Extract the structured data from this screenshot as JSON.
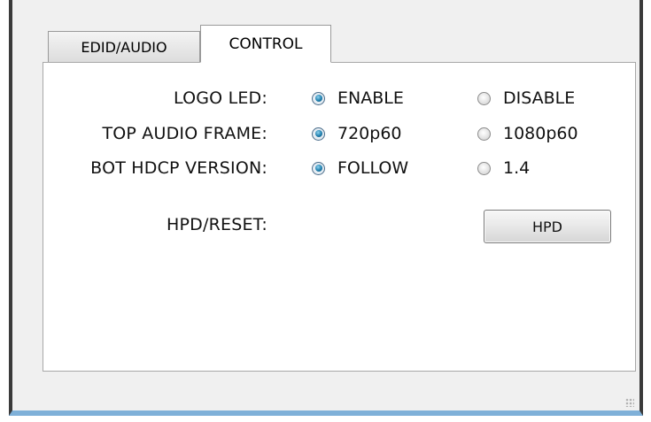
{
  "tabs": [
    {
      "label": "EDID/AUDIO",
      "selected": false
    },
    {
      "label": "CONTROL",
      "selected": true
    }
  ],
  "rows": [
    {
      "label": "LOGO LED:",
      "options": [
        "ENABLE",
        "DISABLE"
      ],
      "selected": 0
    },
    {
      "label": "TOP AUDIO FRAME:",
      "options": [
        "720p60",
        "1080p60"
      ],
      "selected": 0
    },
    {
      "label": "BOT HDCP VERSION:",
      "options": [
        "FOLLOW",
        "1.4"
      ],
      "selected": 0
    }
  ],
  "hpd": {
    "label": "HPD/RESET:",
    "button_label": "HPD"
  },
  "colors": {
    "radio_selected": "#1f7fae",
    "window_border_bottom": "#7fb0d8"
  }
}
